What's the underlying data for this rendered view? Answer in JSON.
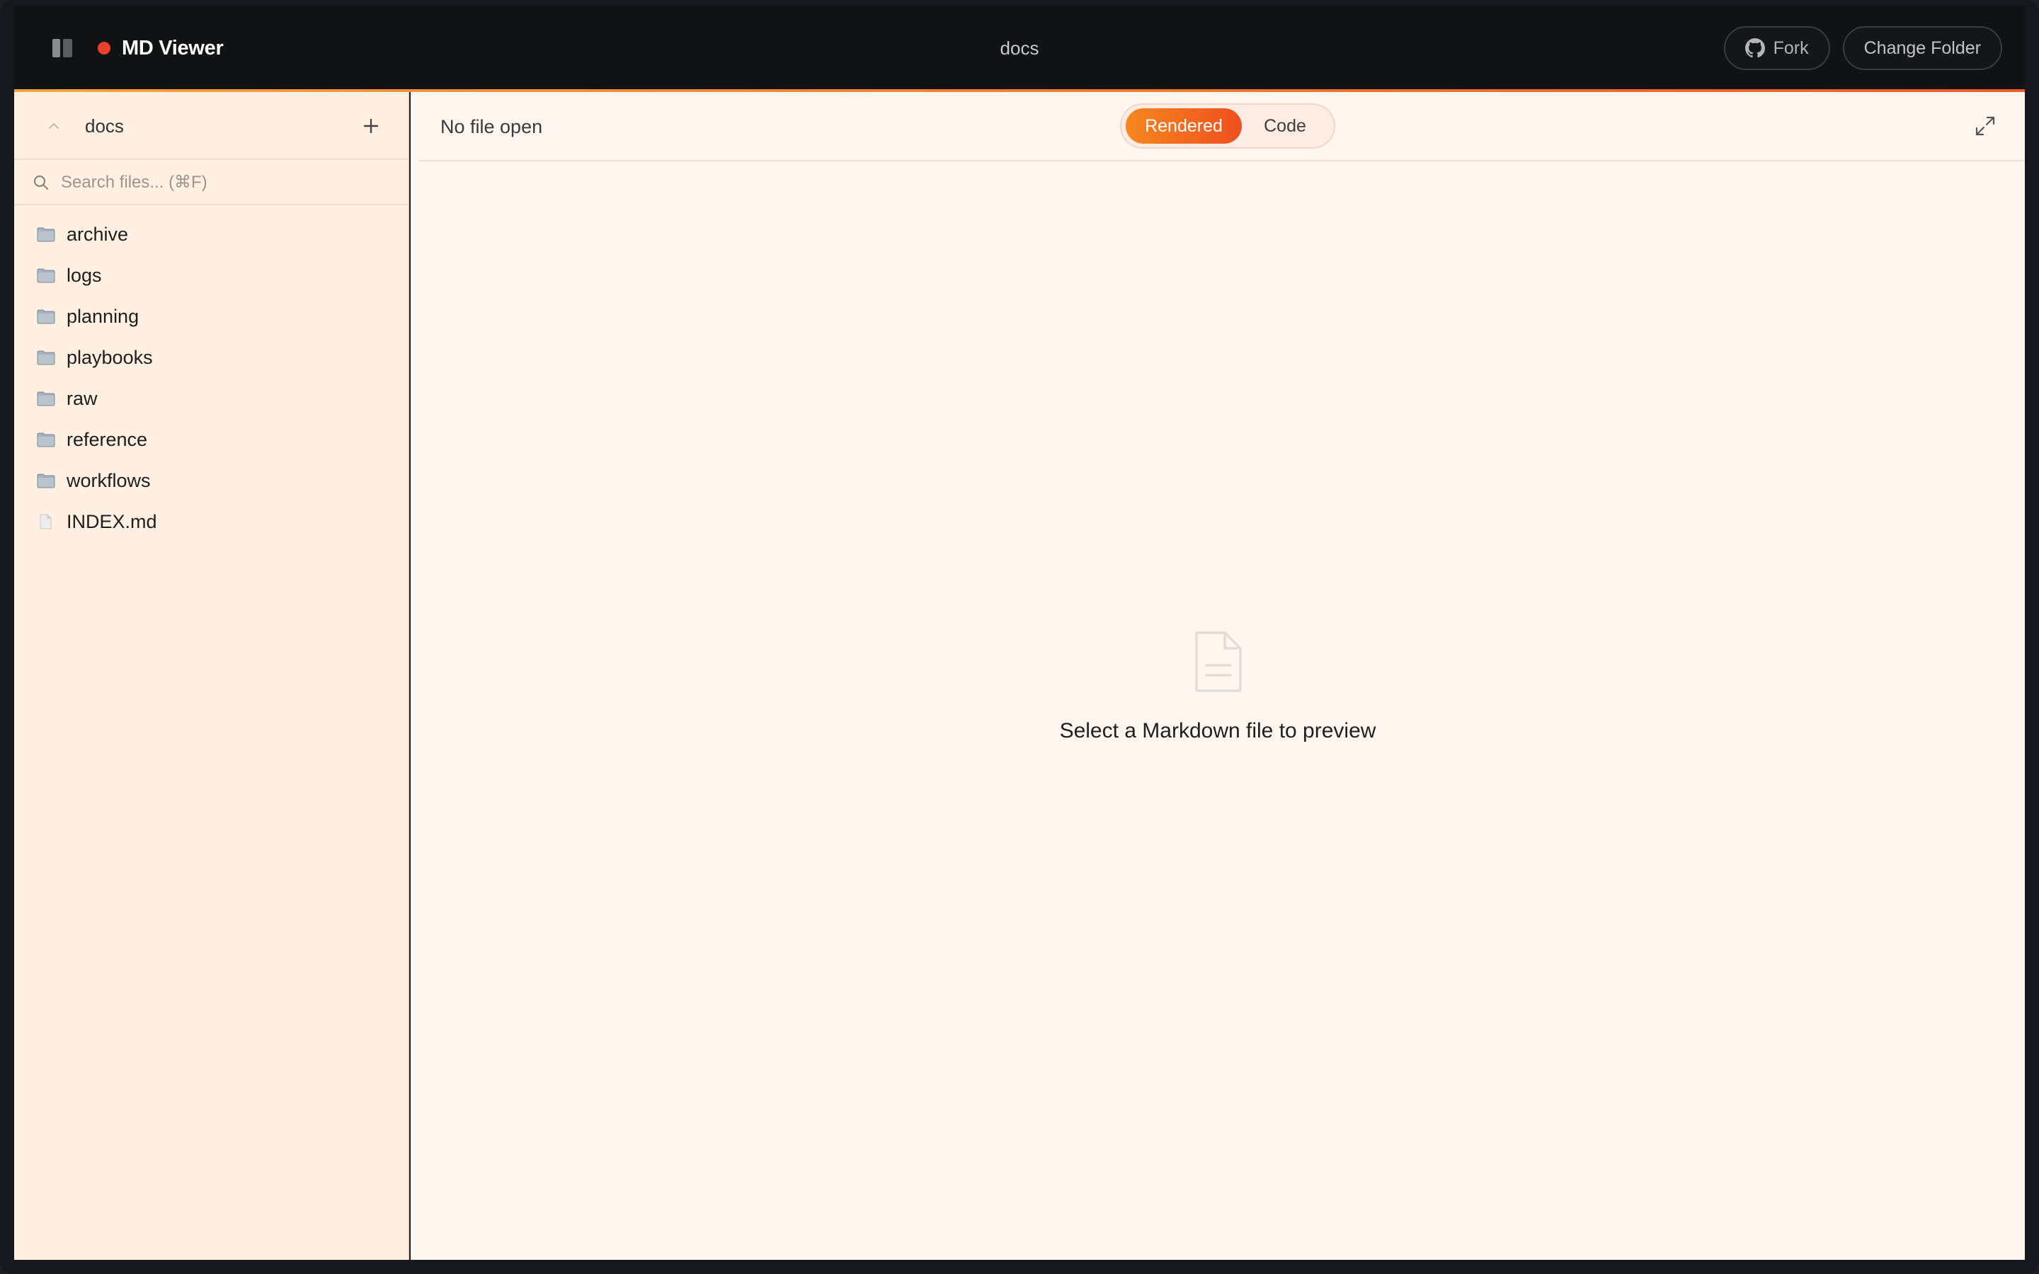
{
  "titlebar": {
    "app_name": "MD Viewer",
    "folder_name": "docs",
    "fork_label": "Fork",
    "change_folder_label": "Change Folder"
  },
  "sidebar": {
    "root_name": "docs",
    "search_placeholder": "Search files... (⌘F)",
    "items": [
      {
        "label": "archive",
        "type": "folder"
      },
      {
        "label": "logs",
        "type": "folder"
      },
      {
        "label": "planning",
        "type": "folder"
      },
      {
        "label": "playbooks",
        "type": "folder"
      },
      {
        "label": "raw",
        "type": "folder"
      },
      {
        "label": "reference",
        "type": "folder"
      },
      {
        "label": "workflows",
        "type": "folder"
      },
      {
        "label": "INDEX.md",
        "type": "file"
      }
    ]
  },
  "main": {
    "file_title": "No file open",
    "view_modes": {
      "rendered": "Rendered",
      "code": "Code",
      "selected": "Rendered"
    },
    "empty_message": "Select a Markdown file to preview"
  },
  "icons": {
    "sidebar_toggle": "sidebar-toggle-icon",
    "collapse": "chevron-up-icon",
    "add": "plus-icon",
    "search": "search-icon",
    "folder": "folder-icon",
    "file": "file-icon",
    "expand": "expand-icon",
    "document": "document-icon",
    "github": "github-icon"
  },
  "colors": {
    "accent_start": "#f7871f",
    "accent_end": "#ee4f1f",
    "app_dot": "#e8412c",
    "titlebar_bg": "#111213",
    "sidebar_bg": "#fff0e1",
    "main_bg": "#fff6ef"
  }
}
